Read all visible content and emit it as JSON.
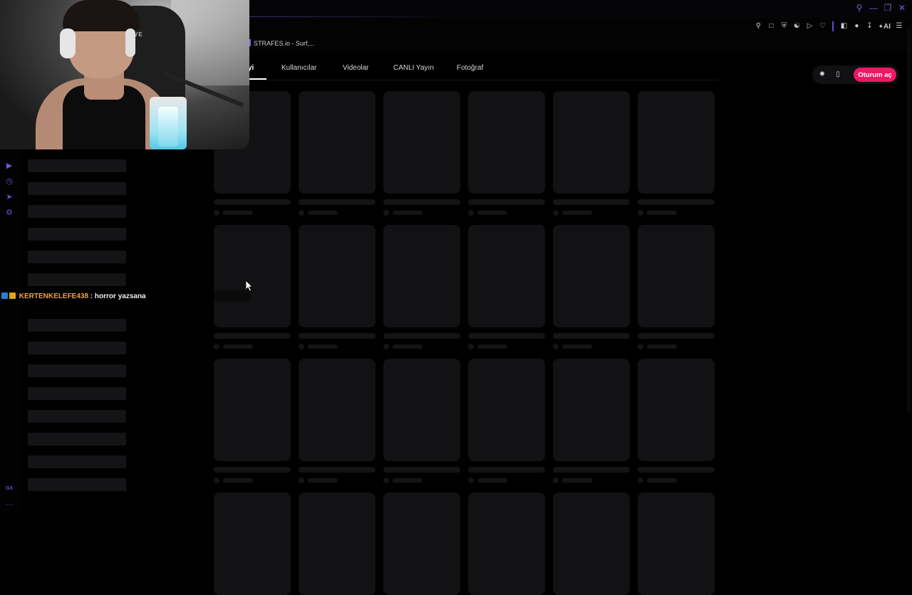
{
  "browser": {
    "tab_title": "STRAFES.io - Surf,...",
    "window_buttons": [
      "search-icon",
      "minimize-icon",
      "restore-icon",
      "close-icon"
    ],
    "toolbar_icons": [
      "pin-icon",
      "snapshot-icon",
      "shield-icon",
      "translate-icon",
      "play-icon",
      "heart-icon",
      "extensions-icon",
      "profile-icon",
      "download-icon",
      "ai-icon",
      "menu-icon"
    ],
    "ai_label": "AI"
  },
  "rail_icons": [
    "play-circle-icon",
    "history-icon",
    "messenger-icon",
    "settings-icon"
  ],
  "rail_footer": {
    "gx_label": "GX",
    "more_label": "···"
  },
  "chat": {
    "message": {
      "username": "KERTENKELEFE438",
      "separator": " : ",
      "text": "horror yazsana"
    }
  },
  "nav": {
    "tabs": [
      {
        "label": "yi",
        "active": true
      },
      {
        "label": "Kullanıcılar",
        "active": false
      },
      {
        "label": "Videolar",
        "active": false
      },
      {
        "label": "CANLI Yayın",
        "active": false
      },
      {
        "label": "Fotoğraf",
        "active": false
      }
    ]
  },
  "header_actions": {
    "login_label": "Oturum aç",
    "icons": [
      "compass-icon",
      "mobile-icon"
    ]
  },
  "webcam": {
    "chair_brand": "RIVE"
  },
  "colors": {
    "accent": "#ee1762",
    "browser_accent": "#6b4fd1"
  }
}
